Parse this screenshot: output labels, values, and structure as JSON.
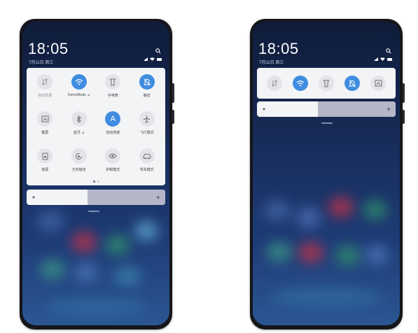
{
  "colors": {
    "accent": "#3f8de0",
    "panel": "#f3f4f6",
    "tile_off": "#e2e4e8"
  },
  "left_phone": {
    "time": "18:05",
    "date": "7月11日 周三",
    "tiles": [
      {
        "label": "移动数据",
        "icon": "data-arrows-icon",
        "active": false,
        "dim": true
      },
      {
        "label": "DemoMode ⊿",
        "icon": "wifi-icon",
        "active": true,
        "dim": false
      },
      {
        "label": "手电筒",
        "icon": "flashlight-icon",
        "active": false,
        "dim": false
      },
      {
        "label": "静音",
        "icon": "bell-mute-icon",
        "active": true,
        "dim": false
      },
      {
        "label": "截屏",
        "icon": "screenshot-icon",
        "active": false,
        "dim": false
      },
      {
        "label": "蓝牙 ⊿",
        "icon": "bluetooth-icon",
        "active": false,
        "dim": false
      },
      {
        "label": "自动亮度",
        "icon": "auto-brightness-icon",
        "active": true,
        "dim": false
      },
      {
        "label": "飞行模式",
        "icon": "airplane-icon",
        "active": false,
        "dim": false
      },
      {
        "label": "锁屏",
        "icon": "lock-screen-icon",
        "active": false,
        "dim": false
      },
      {
        "label": "方向锁定",
        "icon": "rotation-lock-icon",
        "active": false,
        "dim": false
      },
      {
        "label": "护眼模式",
        "icon": "eye-icon",
        "active": false,
        "dim": false
      },
      {
        "label": "驾车模式",
        "icon": "car-icon",
        "active": false,
        "dim": false
      }
    ],
    "auto_brightness_letter": "A",
    "page_indicator": {
      "pages": 2,
      "current": 1
    },
    "brightness_level": 0.44
  },
  "right_phone": {
    "time": "18:05",
    "date": "7月11日 周三",
    "tiles": [
      {
        "icon": "data-arrows-icon",
        "active": false
      },
      {
        "icon": "wifi-icon",
        "active": true
      },
      {
        "icon": "flashlight-icon",
        "active": false
      },
      {
        "icon": "bell-mute-icon",
        "active": true
      },
      {
        "icon": "screenshot-icon",
        "active": false
      }
    ],
    "brightness_level": 0.44
  }
}
